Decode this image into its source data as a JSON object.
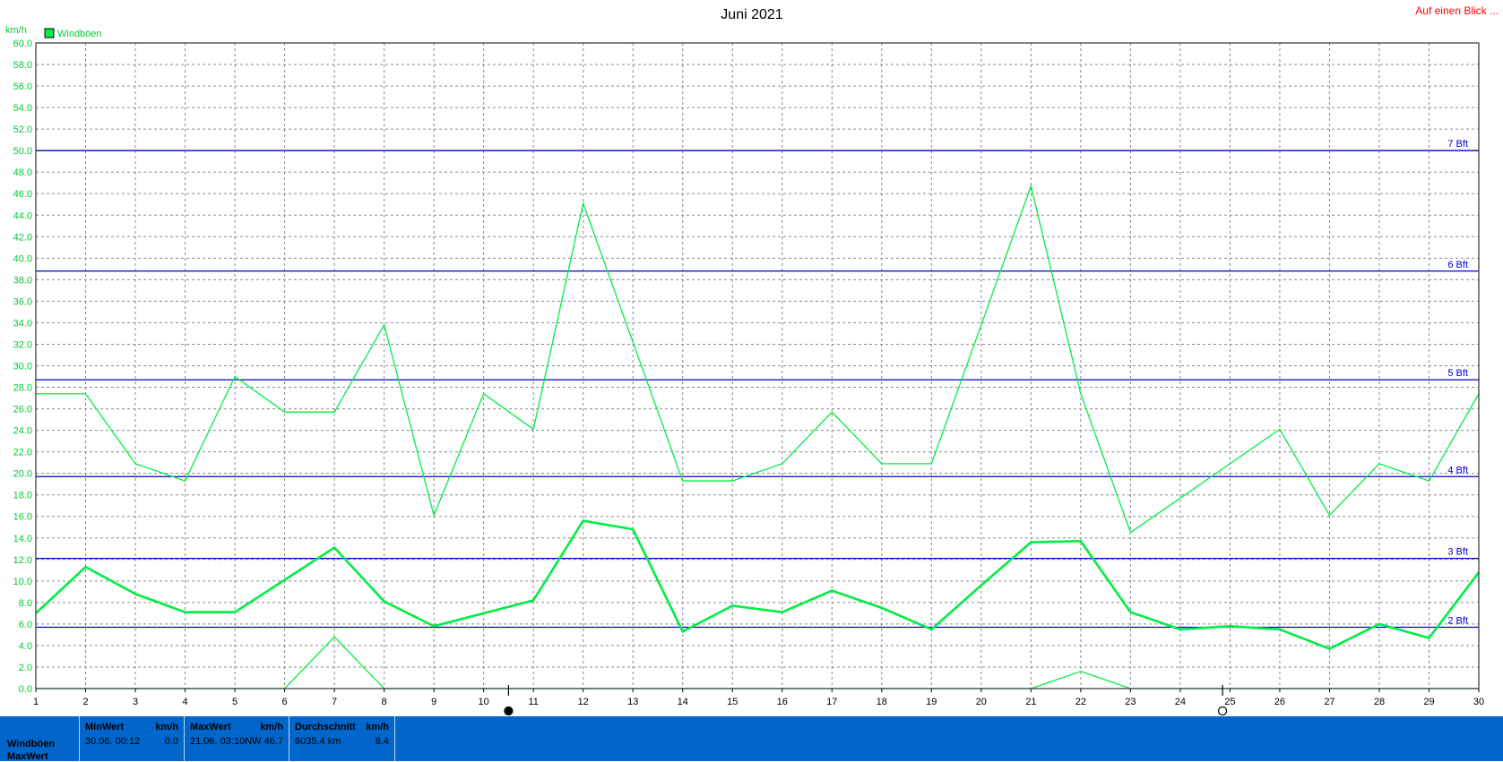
{
  "chart_data": {
    "type": "line",
    "title": "Juni 2021",
    "ylabel": "km/h",
    "ylim": [
      0,
      60
    ],
    "ytick_step": 2,
    "x": [
      1,
      2,
      3,
      4,
      5,
      6,
      7,
      8,
      9,
      10,
      11,
      12,
      13,
      14,
      15,
      16,
      17,
      18,
      19,
      20,
      21,
      22,
      23,
      24,
      25,
      26,
      27,
      28,
      29,
      30
    ],
    "grid": true,
    "legend": {
      "position": "top-left",
      "entries": [
        {
          "name": "Windböen",
          "color": "#00ee44"
        }
      ]
    },
    "series": [
      {
        "name": "Windböen",
        "role": "max",
        "color": "#00ee44",
        "values": [
          27.4,
          27.4,
          20.9,
          19.3,
          29.0,
          25.7,
          25.7,
          33.8,
          16.1,
          27.4,
          24.1,
          45.1,
          32.2,
          19.3,
          19.3,
          20.9,
          25.7,
          20.9,
          20.9,
          33.8,
          46.7,
          27.4,
          14.5,
          17.7,
          20.9,
          24.1,
          16.1,
          20.9,
          19.3,
          27.4
        ]
      },
      {
        "name": "Windböen",
        "role": "mean",
        "color": "#00ee44",
        "values": [
          7.0,
          11.3,
          8.8,
          7.1,
          7.1,
          10.1,
          13.1,
          8.1,
          5.8,
          7.0,
          8.2,
          15.6,
          14.8,
          5.3,
          7.7,
          7.1,
          9.1,
          7.5,
          5.5,
          9.6,
          13.6,
          13.7,
          7.1,
          5.5,
          5.8,
          5.5,
          3.7,
          6.0,
          4.7,
          10.8
        ]
      },
      {
        "name": "Windböen",
        "role": "min",
        "color": "#00ee44",
        "values": [
          0.0,
          0.0,
          0.0,
          0.0,
          0.0,
          0.0,
          4.8,
          0.0,
          0.0,
          0.0,
          0.0,
          0.0,
          0.0,
          0.0,
          0.0,
          0.0,
          0.0,
          0.0,
          0.0,
          0.0,
          0.0,
          1.6,
          0.0,
          0.0,
          0.0,
          0.0,
          0.0,
          0.0,
          0.0,
          0.0
        ]
      }
    ],
    "reference_lines": [
      {
        "label": "2 Bft",
        "value": 5.7
      },
      {
        "label": "3 Bft",
        "value": 12.1
      },
      {
        "label": "4 Bft",
        "value": 19.7
      },
      {
        "label": "5 Bft",
        "value": 28.7
      },
      {
        "label": "6 Bft",
        "value": 38.8
      },
      {
        "label": "7 Bft",
        "value": 50.0
      }
    ],
    "moon_markers": [
      {
        "day": 10.5,
        "phase": "new"
      },
      {
        "day": 24.85,
        "phase": "full"
      }
    ]
  },
  "header": {
    "link_label": "Auf einen Blick ..."
  },
  "stats": {
    "row1_label": "Windböen",
    "row2_label": "MaxWert",
    "min": {
      "header": "MinWert",
      "unit": "km/h",
      "date": "30.06.",
      "time": "00:12",
      "value": "0.0"
    },
    "max": {
      "header": "MaxWert",
      "unit": "km/h",
      "date": "21.06.",
      "time": "03:10",
      "dir": "NW",
      "value": "46.7"
    },
    "avg": {
      "header": "Durchschnitt",
      "unit": "km/h",
      "distance": "6035.4 km",
      "value": "8.4"
    }
  }
}
